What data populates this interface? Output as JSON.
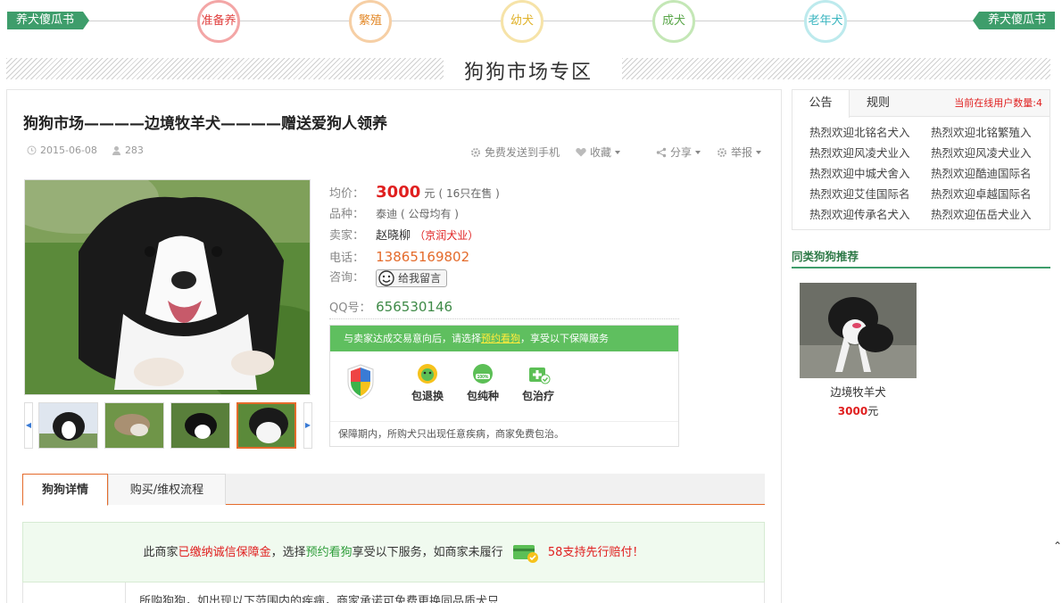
{
  "timeline": {
    "left_tag": "养犬傻瓜书",
    "right_tag": "养犬傻瓜书",
    "stages": [
      {
        "label": "准备养",
        "color": "#f08a8a",
        "text_color": "#e0403f"
      },
      {
        "label": "繁殖",
        "color": "#f5c08a",
        "text_color": "#e38a2b"
      },
      {
        "label": "幼犬",
        "color": "#f7e08f",
        "text_color": "#e0b22b"
      },
      {
        "label": "成犬",
        "color": "#b6e3a4",
        "text_color": "#5aa64a"
      },
      {
        "label": "老年犬",
        "color": "#a9e6ea",
        "text_color": "#3cb6c0"
      }
    ]
  },
  "section_title": "狗狗市场专区",
  "listing": {
    "title": "狗狗市场————边境牧羊犬————赠送爱狗人领养",
    "date": "2015-06-08",
    "views": "283",
    "actions": {
      "send_to_phone": "免费发送到手机",
      "favorite": "收藏",
      "share": "分享",
      "report": "举报"
    },
    "price_label": "均价：",
    "price": "3000",
    "price_unit": "元",
    "stock": "( 16只在售 )",
    "breed_label": "品种：",
    "breed": "泰迪 ( 公母均有 )",
    "seller_label": "卖家：",
    "seller": "赵晓柳",
    "shop": "（京润犬业）",
    "phone_label": "电话：",
    "phone": "13865169802",
    "consult_label": "咨询：",
    "message_button": "给我留言",
    "qq_label": "QQ号：",
    "qq": "656530146"
  },
  "guarantee": {
    "bar_prefix": "与卖家达成交易意向后，请选择",
    "bar_link": "预约看狗",
    "bar_suffix": "，享受以下保障服务",
    "items": [
      "包退换",
      "包纯种",
      "包治疗"
    ],
    "footer": "保障期内，所购犬只出现任意疾病，商家免费包治。"
  },
  "tabs": {
    "details": "狗狗详情",
    "process": "购买/维权流程"
  },
  "notice": {
    "part1": "此商家",
    "part2": "已缴纳诚信保障金",
    "part3": "，选择",
    "part4": "预约看狗",
    "part5": "享受以下服务，如商家未履行",
    "part6": "58支持先行赔付！"
  },
  "detail_text": "所购狗狗，如出现以下范围内的疾病，商家承诺可免费更换同品质犬只",
  "sidebar": {
    "tab_notice": "公告",
    "tab_rules": "规则",
    "online": "当前在线用户数量:4",
    "welcome_left": [
      "热烈欢迎北铭名犬入",
      "热烈欢迎风凌犬业入",
      "热烈欢迎中城犬舍入",
      "热烈欢迎艾佳国际名",
      "热烈欢迎传承名犬入"
    ],
    "welcome_right": [
      "热烈欢迎北铭繁殖入",
      "热烈欢迎风凌犬业入",
      "热烈欢迎酷迪国际名",
      "热烈欢迎卓越国际名",
      "热烈欢迎伍岳犬业入"
    ],
    "rec_title": "同类狗狗推荐",
    "rec_name": "边境牧羊犬",
    "rec_price": "3000",
    "rec_unit": "元"
  },
  "colors": {
    "accent_orange": "#e46b2b",
    "price_red": "#e02020",
    "brand_green": "#3e9d6b"
  }
}
